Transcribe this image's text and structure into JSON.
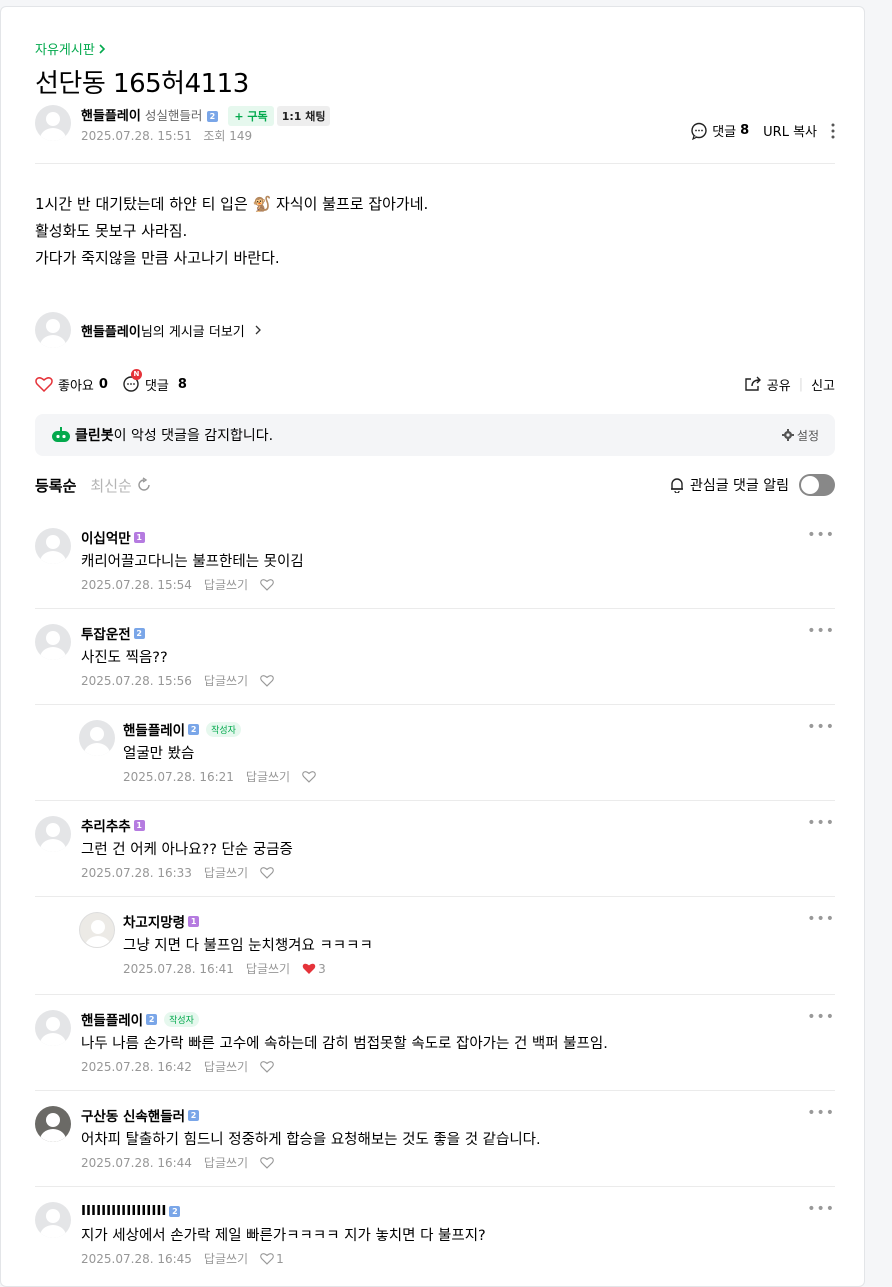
{
  "board": {
    "label": "자유게시판"
  },
  "post": {
    "title": "선단동 165허4113",
    "author": "핸들플레이",
    "rank": "성실핸들러",
    "grade": "2",
    "subscribe_label": "+ 구독",
    "chat_label": "1:1 채팅",
    "date": "2025.07.28. 15:51",
    "views_label": "조회 149",
    "comment_label": "댓글",
    "comment_count": "8",
    "url_copy_label": "URL 복사",
    "body_lines": [
      "1시간 반 대기탔는데 하얀 티 입은 🐒 자식이 불프로 잡아가네.",
      "활성화도 못보구 사라짐.",
      "가다가 죽지않을 만큼 사고나기 바란다."
    ],
    "more_posts_name": "핸들플레이",
    "more_posts_suffix": "님의 게시글 더보기",
    "like_label": "좋아요",
    "like_count": "0",
    "comment_badge": "N",
    "share_label": "공유",
    "report_label": "신고"
  },
  "cleanbot": {
    "name": "클린봇",
    "text": "이 악성 댓글을 감지합니다.",
    "settings_label": "설정"
  },
  "sort": {
    "registered": "등록순",
    "latest": "최신순",
    "alarm_label": "관심글 댓글 알림"
  },
  "comments": [
    {
      "name": "이십억만",
      "grade": "1",
      "grade_color": "#b57be0",
      "writer": "",
      "text": "캐리어끌고다니는 불프한테는 못이김",
      "date": "2025.07.28. 15:54",
      "reply_label": "답글쓰기",
      "likes": ""
    },
    {
      "name": "투잡운전",
      "grade": "2",
      "grade_color": "#7aa6e8",
      "writer": "",
      "text": "사진도 찍음??",
      "date": "2025.07.28. 15:56",
      "reply_label": "답글쓰기",
      "likes": ""
    },
    {
      "name": "핸들플레이",
      "grade": "2",
      "grade_color": "#7aa6e8",
      "writer": "작성자",
      "text": "얼굴만 봤슴",
      "date": "2025.07.28. 16:21",
      "reply_label": "답글쓰기",
      "likes": ""
    },
    {
      "name": "추리추추",
      "grade": "1",
      "grade_color": "#b57be0",
      "writer": "",
      "text": "그런 건 어케 아나요?? 단순 궁금증",
      "date": "2025.07.28. 16:33",
      "reply_label": "답글쓰기",
      "likes": ""
    },
    {
      "name": "차고지망령",
      "grade": "1",
      "grade_color": "#b57be0",
      "writer": "",
      "text": "그냥 지면 다 불프임 눈치챙겨요 ㅋㅋㅋㅋ",
      "date": "2025.07.28. 16:41",
      "reply_label": "답글쓰기",
      "likes": "3"
    },
    {
      "name": "핸들플레이",
      "grade": "2",
      "grade_color": "#7aa6e8",
      "writer": "작성자",
      "text": "나두 나름 손가락 빠른 고수에 속하는데 감히 범접못할 속도로 잡아가는 건 백퍼 불프임.",
      "date": "2025.07.28. 16:42",
      "reply_label": "답글쓰기",
      "likes": ""
    },
    {
      "name": "구산동 신속핸들러",
      "grade": "2",
      "grade_color": "#7aa6e8",
      "writer": "",
      "text": "어차피 탈출하기 힘드니 정중하게 합승을 요청해보는 것도 좋을 것 같습니다.",
      "date": "2025.07.28. 16:44",
      "reply_label": "답글쓰기",
      "likes": ""
    },
    {
      "name": "IIIIIIIIIIIIIIIII",
      "grade": "2",
      "grade_color": "#7aa6e8",
      "writer": "",
      "text": "지가 세상에서 손가락 제일 빠른가ㅋㅋㅋㅋ 지가 놓치면 다 불프지?",
      "date": "2025.07.28. 16:45",
      "reply_label": "답글쓰기",
      "likes": "1"
    }
  ],
  "colors": {
    "accent": "#03a94d",
    "like_red": "#e5333a",
    "meta_gray": "#979797"
  }
}
